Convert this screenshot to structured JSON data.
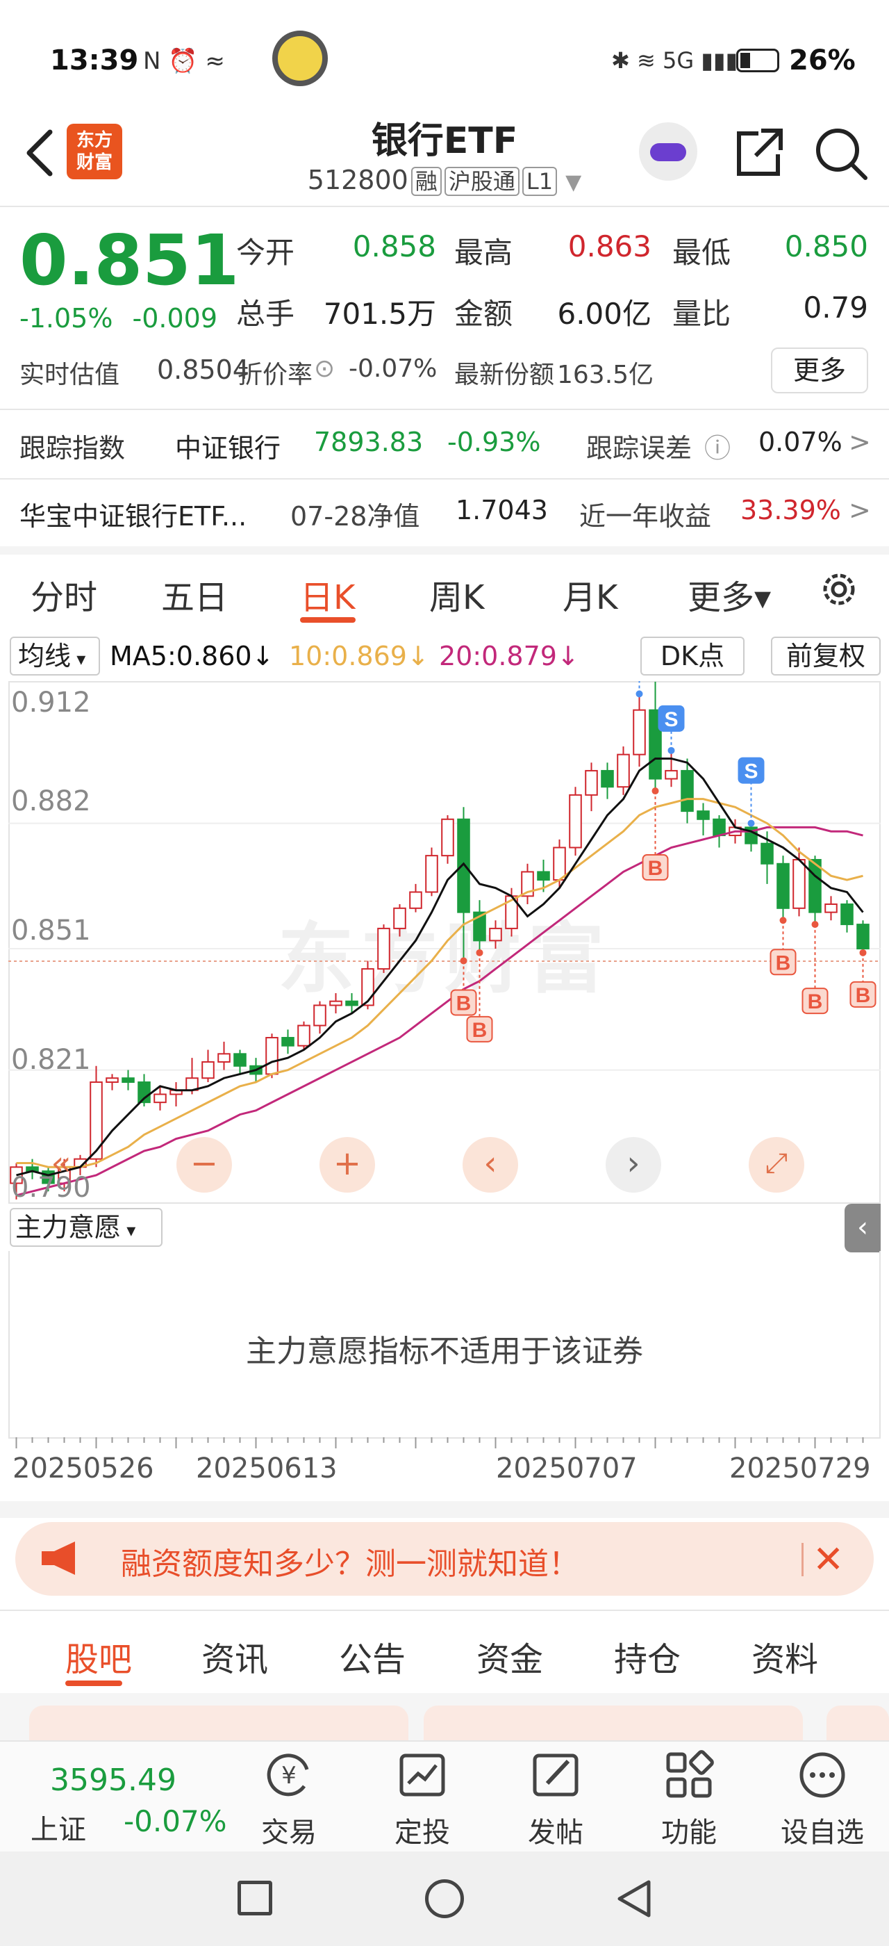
{
  "status_bar": {
    "time": "13:39",
    "battery": "26%",
    "icons_left": "N ⏰ ≈",
    "icons_right": "✱ ≋ 5G ▮▮▮"
  },
  "header": {
    "title": "银行ETF",
    "code": "512800",
    "tags": [
      "融",
      "沪股通",
      "L1"
    ],
    "logo_text_1": "东方",
    "logo_text_2": "财富"
  },
  "quote": {
    "price": "0.851",
    "change_pct": "-1.05%",
    "change": "-0.009",
    "open_label": "今开",
    "open": "0.858",
    "high_label": "最高",
    "high": "0.863",
    "low_label": "最低",
    "low": "0.850",
    "volume_label": "总手",
    "volume": "701.5万",
    "amount_label": "金额",
    "amount": "6.00亿",
    "ratio_label": "量比",
    "ratio": "0.79",
    "iopv_label": "实时估值",
    "iopv": "0.8504",
    "premium_label": "折价率",
    "premium": "-0.07%",
    "shares_label": "最新份额",
    "shares": "163.5亿",
    "more": "更多"
  },
  "tracking": {
    "label": "跟踪指数",
    "index": "中证银行",
    "value": "7893.83",
    "change": "-0.93%",
    "error_label": "跟踪误差",
    "error": "0.07%"
  },
  "fund": {
    "name": "华宝中证银行ETF...",
    "nav_label": "07-28净值",
    "nav": "1.7043",
    "return_label": "近一年收益",
    "return": "33.39%"
  },
  "kline_tabs": [
    "分时",
    "五日",
    "日K",
    "周K",
    "月K",
    "更多▾"
  ],
  "chart_toolbar": {
    "ma_select": "均线",
    "ma5": "MA5:0.860↓",
    "ma10": "10:0.869↓",
    "ma20": "20:0.879↓",
    "dk": "DK点",
    "adjust": "前复权"
  },
  "chart_colors": {
    "up": "#d0262d",
    "down": "#1a9c3e",
    "ma5": "#111111",
    "ma10": "#e9b04a",
    "ma20": "#c2287a"
  },
  "chart_data": {
    "type": "candlestick",
    "y_ticks": [
      "0.912",
      "0.882",
      "0.851",
      "0.821",
      "0.790"
    ],
    "ylim": [
      0.79,
      0.912
    ],
    "x_labels": [
      "20250526",
      "20250613",
      "20250707",
      "20250729"
    ],
    "candles": [
      [
        0.793,
        0.797,
        0.789,
        0.798
      ],
      [
        0.797,
        0.796,
        0.794,
        0.799
      ],
      [
        0.796,
        0.793,
        0.791,
        0.797
      ],
      [
        0.793,
        0.797,
        0.791,
        0.799
      ],
      [
        0.797,
        0.799,
        0.795,
        0.8
      ],
      [
        0.799,
        0.818,
        0.797,
        0.822
      ],
      [
        0.818,
        0.819,
        0.816,
        0.82
      ],
      [
        0.819,
        0.818,
        0.816,
        0.821
      ],
      [
        0.818,
        0.813,
        0.812,
        0.82
      ],
      [
        0.813,
        0.815,
        0.811,
        0.817
      ],
      [
        0.815,
        0.816,
        0.812,
        0.818
      ],
      [
        0.816,
        0.819,
        0.815,
        0.824
      ],
      [
        0.819,
        0.823,
        0.818,
        0.826
      ],
      [
        0.823,
        0.825,
        0.821,
        0.828
      ],
      [
        0.825,
        0.822,
        0.82,
        0.826
      ],
      [
        0.822,
        0.82,
        0.818,
        0.824
      ],
      [
        0.82,
        0.829,
        0.819,
        0.83
      ],
      [
        0.829,
        0.827,
        0.825,
        0.831
      ],
      [
        0.827,
        0.832,
        0.826,
        0.833
      ],
      [
        0.832,
        0.837,
        0.83,
        0.838
      ],
      [
        0.837,
        0.838,
        0.835,
        0.84
      ],
      [
        0.838,
        0.837,
        0.835,
        0.84
      ],
      [
        0.837,
        0.846,
        0.836,
        0.848
      ],
      [
        0.846,
        0.856,
        0.845,
        0.857
      ],
      [
        0.856,
        0.861,
        0.854,
        0.862
      ],
      [
        0.861,
        0.865,
        0.86,
        0.867
      ],
      [
        0.865,
        0.874,
        0.864,
        0.876
      ],
      [
        0.874,
        0.883,
        0.872,
        0.884
      ],
      [
        0.883,
        0.86,
        0.848,
        0.886
      ],
      [
        0.86,
        0.853,
        0.85,
        0.863
      ],
      [
        0.853,
        0.856,
        0.851,
        0.858
      ],
      [
        0.856,
        0.864,
        0.854,
        0.866
      ],
      [
        0.864,
        0.87,
        0.862,
        0.872
      ],
      [
        0.87,
        0.868,
        0.865,
        0.873
      ],
      [
        0.868,
        0.876,
        0.866,
        0.878
      ],
      [
        0.876,
        0.889,
        0.874,
        0.891
      ],
      [
        0.889,
        0.895,
        0.885,
        0.897
      ],
      [
        0.895,
        0.891,
        0.888,
        0.897
      ],
      [
        0.891,
        0.899,
        0.889,
        0.901
      ],
      [
        0.899,
        0.91,
        0.896,
        0.914
      ],
      [
        0.91,
        0.893,
        0.89,
        0.917
      ],
      [
        0.893,
        0.895,
        0.891,
        0.9
      ],
      [
        0.895,
        0.885,
        0.882,
        0.898
      ],
      [
        0.885,
        0.883,
        0.879,
        0.887
      ],
      [
        0.883,
        0.879,
        0.876,
        0.884
      ],
      [
        0.879,
        0.881,
        0.877,
        0.883
      ],
      [
        0.881,
        0.877,
        0.875,
        0.882
      ],
      [
        0.877,
        0.872,
        0.867,
        0.88
      ],
      [
        0.872,
        0.861,
        0.858,
        0.874
      ],
      [
        0.861,
        0.873,
        0.859,
        0.876
      ],
      [
        0.873,
        0.86,
        0.857,
        0.874
      ],
      [
        0.86,
        0.862,
        0.858,
        0.864
      ],
      [
        0.862,
        0.857,
        0.855,
        0.863
      ],
      [
        0.857,
        0.851,
        0.85,
        0.858
      ]
    ],
    "ma5": [
      0.795,
      0.796,
      0.795,
      0.796,
      0.797,
      0.801,
      0.806,
      0.81,
      0.814,
      0.817,
      0.816,
      0.816,
      0.817,
      0.819,
      0.82,
      0.821,
      0.823,
      0.824,
      0.826,
      0.829,
      0.833,
      0.835,
      0.838,
      0.843,
      0.848,
      0.853,
      0.86,
      0.868,
      0.872,
      0.867,
      0.866,
      0.864,
      0.859,
      0.862,
      0.866,
      0.872,
      0.878,
      0.884,
      0.888,
      0.895,
      0.898,
      0.898,
      0.897,
      0.893,
      0.887,
      0.881,
      0.88,
      0.878,
      0.876,
      0.873,
      0.869,
      0.866,
      0.865,
      0.86
    ],
    "ma10": [
      0.798,
      0.798,
      0.797,
      0.797,
      0.797,
      0.798,
      0.8,
      0.802,
      0.805,
      0.807,
      0.809,
      0.811,
      0.813,
      0.815,
      0.817,
      0.818,
      0.82,
      0.821,
      0.823,
      0.825,
      0.827,
      0.829,
      0.832,
      0.836,
      0.84,
      0.844,
      0.848,
      0.853,
      0.857,
      0.859,
      0.861,
      0.863,
      0.865,
      0.866,
      0.868,
      0.871,
      0.874,
      0.877,
      0.88,
      0.884,
      0.886,
      0.887,
      0.888,
      0.888,
      0.887,
      0.886,
      0.884,
      0.882,
      0.879,
      0.875,
      0.872,
      0.869,
      0.868,
      0.869
    ],
    "ma20": [
      0.79,
      0.791,
      0.792,
      0.793,
      0.794,
      0.795,
      0.797,
      0.799,
      0.801,
      0.802,
      0.804,
      0.805,
      0.806,
      0.808,
      0.81,
      0.811,
      0.813,
      0.815,
      0.817,
      0.819,
      0.821,
      0.823,
      0.825,
      0.827,
      0.829,
      0.832,
      0.835,
      0.838,
      0.841,
      0.843,
      0.846,
      0.849,
      0.852,
      0.855,
      0.858,
      0.861,
      0.864,
      0.867,
      0.87,
      0.872,
      0.874,
      0.876,
      0.877,
      0.878,
      0.879,
      0.88,
      0.88,
      0.881,
      0.881,
      0.881,
      0.881,
      0.88,
      0.88,
      0.879
    ],
    "signals": [
      {
        "type": "B",
        "index": 28
      },
      {
        "type": "B",
        "index": 29
      },
      {
        "type": "S",
        "index": 39
      },
      {
        "type": "B",
        "index": 40
      },
      {
        "type": "S",
        "index": 41
      },
      {
        "type": "S",
        "index": 46
      },
      {
        "type": "B",
        "index": 48
      },
      {
        "type": "B",
        "index": 50
      },
      {
        "type": "B",
        "index": 53
      }
    ]
  },
  "sub_indicator": {
    "select": "主力意愿",
    "message": "主力意愿指标不适用于该证券"
  },
  "promo": {
    "text": "融资额度知多少？测一测就知道！"
  },
  "bottom_tabs": [
    "股吧",
    "资讯",
    "公告",
    "资金",
    "持仓",
    "资料"
  ],
  "footer": {
    "index_value": "3595.49",
    "index_name": "上证",
    "index_change": "-0.07%",
    "nav": [
      {
        "label": "交易",
        "icon": "yen-icon"
      },
      {
        "label": "定投",
        "icon": "chart-icon"
      },
      {
        "label": "发帖",
        "icon": "edit-icon"
      },
      {
        "label": "功能",
        "icon": "grid-icon"
      },
      {
        "label": "设自选",
        "icon": "more-icon"
      }
    ]
  }
}
